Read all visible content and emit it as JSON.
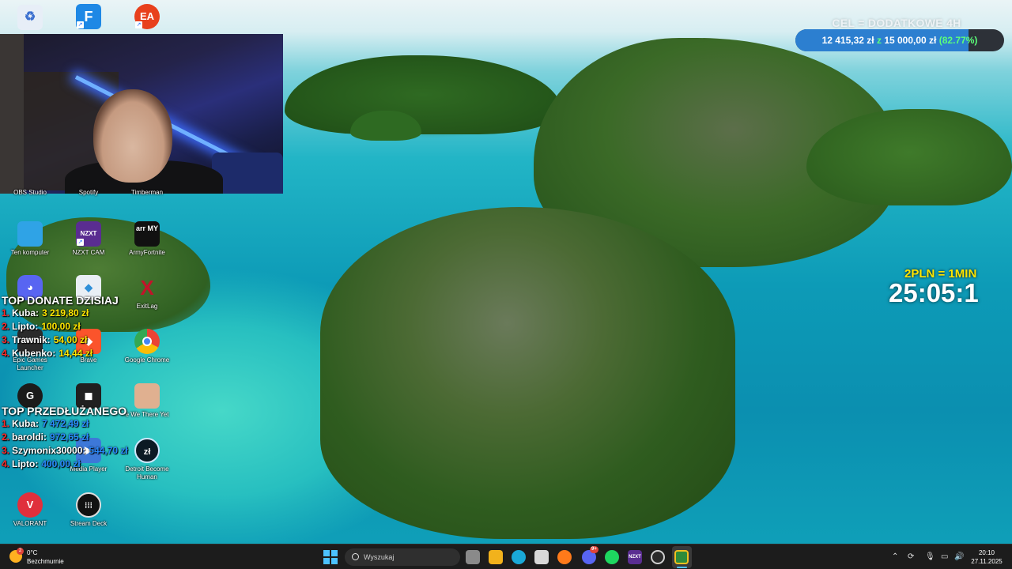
{
  "desktop_icons": [
    {
      "id": "recycle-bin",
      "label": "",
      "icon": "recycle-bin-icon",
      "color": "#3b6fcf"
    },
    {
      "id": "fortnite",
      "label": "",
      "icon": "fortnite-icon",
      "color": "#1e88e5",
      "glyph": "F"
    },
    {
      "id": "ea",
      "label": "",
      "icon": "ea-icon",
      "color": "#e8401c",
      "glyph": "EA"
    },
    {
      "id": "obs",
      "label": "OBS Studio"
    },
    {
      "id": "spotify",
      "label": "Spotify"
    },
    {
      "id": "timberman",
      "label": "Timberman"
    },
    {
      "id": "this-pc",
      "label": "Ten komputer",
      "icon": "monitor-icon",
      "color": "#2fa3e6"
    },
    {
      "id": "nzxt-cam",
      "label": "NZXT CAM",
      "icon": "nzxt-icon",
      "color": "#5a2d91",
      "glyph": "NZXT"
    },
    {
      "id": "army-fortnite",
      "label": "ArmyFortnite",
      "icon": "army-icon",
      "color": "#111111",
      "glyph": "arr MY"
    },
    {
      "id": "discord",
      "label": "",
      "icon": "discord-icon",
      "color": "#5865f2"
    },
    {
      "id": "lossless",
      "label": "",
      "icon": "lossless-icon",
      "color": "#e9eef5"
    },
    {
      "id": "exitlag",
      "label": "ExitLag",
      "icon": "exitlag-icon",
      "color": "#c3132a",
      "glyph": "X"
    },
    {
      "id": "epic",
      "label": "Epic Games Launcher",
      "icon": "epic-icon",
      "color": "#2b2b2b",
      "glyph": "EPIC"
    },
    {
      "id": "brave",
      "label": "Brave",
      "icon": "brave-icon",
      "color": "#fb542b"
    },
    {
      "id": "chrome",
      "label": "Google Chrome",
      "icon": "chrome-icon",
      "color": "#4285f4"
    },
    {
      "id": "logitech",
      "label": "",
      "icon": "logitech-icon",
      "color": "#1b1b1b",
      "glyph": "G"
    },
    {
      "id": "roblox",
      "label": "",
      "icon": "roblox-icon",
      "color": "#202020"
    },
    {
      "id": "we-there-yet",
      "label": "e We There Yet",
      "icon": "game-avatar-icon",
      "color": "#e0b090"
    },
    {
      "id": "media-player",
      "label": "Media Player",
      "icon": "media-player-icon",
      "color": "#3d78d8"
    },
    {
      "id": "detroit",
      "label": "Detroit Become Human",
      "icon": "detroit-icon",
      "color": "#0c1a24"
    },
    {
      "id": "valorant",
      "label": "VALORANT",
      "icon": "valorant-icon",
      "color": "#e0303c"
    },
    {
      "id": "stream-deck",
      "label": "Stream Deck",
      "icon": "stream-deck-icon",
      "color": "#111111"
    }
  ],
  "goal": {
    "title": "CEL = DODATKOWE 4H",
    "current": "12 415,32 zł",
    "separator": "z",
    "target": "15 000,00 zł",
    "percent_label": "(82.77%)",
    "percent": 0.8277,
    "fill_color": "#2c7fd0",
    "percent_color": "#5cff7a"
  },
  "timer": {
    "rate": "2PLN = 1MIN",
    "value": "25:05:1",
    "rate_color": "#ffe600"
  },
  "top_donate": {
    "title": "TOP DONATE DZISIAJ",
    "rows": [
      {
        "rank": "1.",
        "name": "Kuba:",
        "amount": "3 219,80 zł"
      },
      {
        "rank": "2.",
        "name": "Lipto:",
        "amount": "100,00 zł"
      },
      {
        "rank": "3.",
        "name": "Trawnik:",
        "amount": "54,00 zł"
      },
      {
        "rank": "4.",
        "name": "Kubenko:",
        "amount": "14,44 zł"
      }
    ]
  },
  "top_extend": {
    "title": "TOP PRZEDŁUŻANEGO",
    "rows": [
      {
        "rank": "1.",
        "name": "Kuba:",
        "amount": "7 472,49 zł"
      },
      {
        "rank": "2.",
        "name": "baroldi:",
        "amount": "972,65 zł"
      },
      {
        "rank": "3.",
        "name": "Szymonix30000:",
        "amount": "544,70 zł"
      },
      {
        "rank": "4.",
        "name": "Lipto:",
        "amount": "400,00 zł"
      }
    ]
  },
  "taskbar": {
    "weather_temp": "0°C",
    "weather_desc": "Bezchmurnie",
    "weather_badge": "2",
    "search_placeholder": "Wyszukaj",
    "discord_badge": "9+",
    "nzxt_glyph": "NZXT",
    "time": "20:10",
    "date": "27.11.2025",
    "accent": "#4cc2ff"
  }
}
